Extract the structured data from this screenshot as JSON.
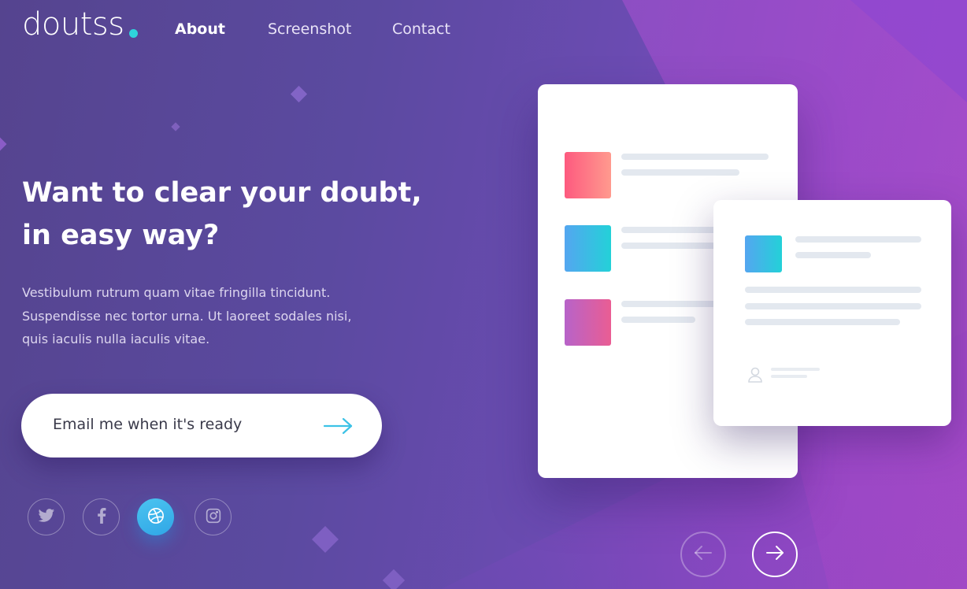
{
  "brand": {
    "name": "doutss",
    "accent_color": "#2fd3dc"
  },
  "nav": {
    "items": [
      {
        "label": "About",
        "active": true
      },
      {
        "label": "Screenshot",
        "active": false
      },
      {
        "label": "Contact",
        "active": false
      }
    ]
  },
  "hero": {
    "headline_lines": [
      "Want to clear your doubt,",
      "in easy way?"
    ],
    "description_lines": [
      "Vestibulum rutrum quam vitae fringilla tincidunt.",
      "Suspendisse nec tortor urna. Ut laoreet sodales nisi,",
      "quis iaculis nulla iaculis vitae."
    ]
  },
  "cta": {
    "label": "Email me when it's ready",
    "icon": "arrow-right-icon"
  },
  "social": [
    {
      "icon": "twitter-icon",
      "active": false
    },
    {
      "icon": "facebook-icon",
      "active": false
    },
    {
      "icon": "dribbble-icon",
      "active": true
    },
    {
      "icon": "instagram-icon",
      "active": false
    }
  ],
  "pager": {
    "prev_icon": "arrow-left-icon",
    "next_icon": "arrow-right-icon"
  },
  "colors": {
    "background_start": "#55448f",
    "background_end": "#a14cc4",
    "thumb_red": "#fd6585",
    "thumb_teal": "#2fd3dc",
    "thumb_purple": "#c063c8",
    "active_social": "#3bb4ec"
  }
}
